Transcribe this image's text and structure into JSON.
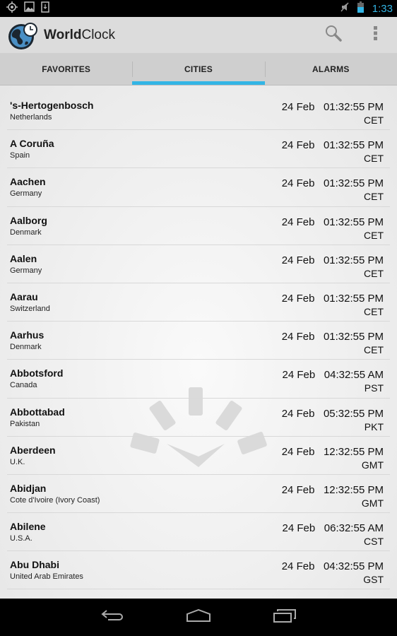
{
  "status_bar": {
    "left_icons": [
      "gps-icon",
      "gallery-icon",
      "download-icon"
    ],
    "right_icons": [
      "mute-icon",
      "battery-icon"
    ],
    "time": "1:33"
  },
  "action_bar": {
    "app_title_bold": "World",
    "app_title_regular": "Clock",
    "actions": [
      "search-icon",
      "overflow-menu-icon"
    ]
  },
  "tabs": [
    {
      "label": "FAVORITES",
      "active": false
    },
    {
      "label": "CITIES",
      "active": true
    },
    {
      "label": "ALARMS",
      "active": false
    }
  ],
  "colors": {
    "accent": "#33b5e5",
    "actionbar": "#dcdcdc",
    "tabbar": "#cfcfcf"
  },
  "cities": [
    {
      "city": "'s-Hertogenbosch",
      "country": "Netherlands",
      "date": "24 Feb",
      "time": "01:32:55 PM",
      "tz": "CET"
    },
    {
      "city": "A Coruña",
      "country": "Spain",
      "date": "24 Feb",
      "time": "01:32:55 PM",
      "tz": "CET"
    },
    {
      "city": "Aachen",
      "country": "Germany",
      "date": "24 Feb",
      "time": "01:32:55 PM",
      "tz": "CET"
    },
    {
      "city": "Aalborg",
      "country": "Denmark",
      "date": "24 Feb",
      "time": "01:32:55 PM",
      "tz": "CET"
    },
    {
      "city": "Aalen",
      "country": "Germany",
      "date": "24 Feb",
      "time": "01:32:55 PM",
      "tz": "CET"
    },
    {
      "city": "Aarau",
      "country": "Switzerland",
      "date": "24 Feb",
      "time": "01:32:55 PM",
      "tz": "CET"
    },
    {
      "city": "Aarhus",
      "country": "Denmark",
      "date": "24 Feb",
      "time": "01:32:55 PM",
      "tz": "CET"
    },
    {
      "city": "Abbotsford",
      "country": "Canada",
      "date": "24 Feb",
      "time": "04:32:55 AM",
      "tz": "PST"
    },
    {
      "city": "Abbottabad",
      "country": "Pakistan",
      "date": "24 Feb",
      "time": "05:32:55 PM",
      "tz": "PKT"
    },
    {
      "city": "Aberdeen",
      "country": "U.K.",
      "date": "24 Feb",
      "time": "12:32:55 PM",
      "tz": "GMT"
    },
    {
      "city": "Abidjan",
      "country": "Cote d'Ivoire (Ivory Coast)",
      "date": "24 Feb",
      "time": "12:32:55 PM",
      "tz": "GMT"
    },
    {
      "city": "Abilene",
      "country": "U.S.A.",
      "date": "24 Feb",
      "time": "06:32:55 AM",
      "tz": "CST"
    },
    {
      "city": "Abu Dhabi",
      "country": "United Arab Emirates",
      "date": "24 Feb",
      "time": "04:32:55 PM",
      "tz": "GST"
    }
  ],
  "nav_bar": [
    "back-icon",
    "home-icon",
    "recent-apps-icon"
  ]
}
